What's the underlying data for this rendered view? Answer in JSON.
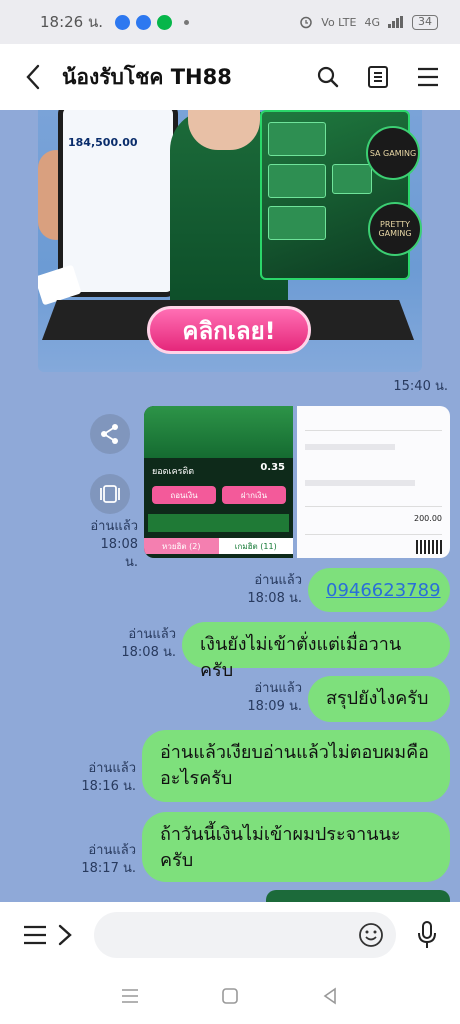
{
  "status_bar": {
    "time": "18:26 น.",
    "battery": "34",
    "network": "4G"
  },
  "header": {
    "title": "น้องรับโชค TH88"
  },
  "banner": {
    "cta_label": "คลิกเลย!",
    "amount_text": "184,500.00",
    "logo_sa": "SA GAMING",
    "logo_pretty": "PRETTY GAMING"
  },
  "messages": {
    "banner_time": "15:40 น.",
    "image_read": "อ่านแล้ว",
    "image_time": "18:08 น.",
    "image_a": {
      "balance_label": "ยอดเครดิต",
      "balance_value": "0.35",
      "btn_withdraw": "ถอนเงิน",
      "btn_deposit": "ฝากเงิน",
      "tab_lotto": "หวยฮิต (2)",
      "tab_games": "เกมฮิต (11)"
    },
    "image_b": {
      "amount": "200.00"
    },
    "phone": {
      "read": "อ่านแล้ว",
      "time": "18:08 น.",
      "text": "0946623789"
    },
    "msg1": {
      "read": "อ่านแล้ว",
      "time": "18:08 น.",
      "text": "เงินยังไม่เข้าตั่งแต่เมื่อวานครับ"
    },
    "msg2": {
      "read": "อ่านแล้ว",
      "time": "18:09 น.",
      "text": "สรุปยังไงครับ"
    },
    "msg3": {
      "read": "อ่านแล้ว",
      "time": "18:16 น.",
      "text": "อ่านแล้วเงียบอ่านแล้วไม่ตอบผมคืออะไรครับ"
    },
    "msg4": {
      "read": "อ่านแล้ว",
      "time": "18:17 น.",
      "text": "ถ้าวันนี้เงินไม่เข้าผมประจานนะครับ"
    }
  },
  "input": {
    "placeholder": ""
  },
  "colors": {
    "chat_bg": "#8fa9d8",
    "bubble_green": "#7ee07c",
    "link_blue": "#2a6fd8"
  }
}
